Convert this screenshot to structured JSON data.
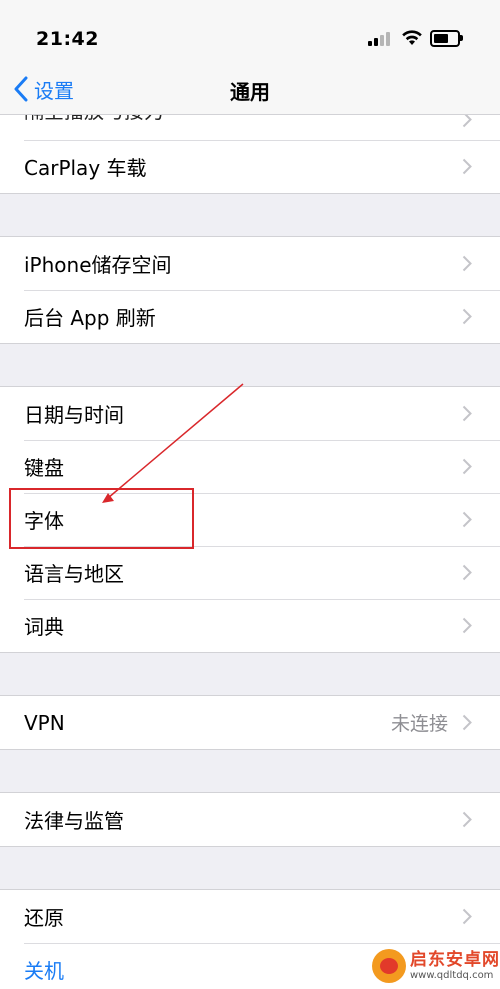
{
  "status_bar": {
    "time": "21:42",
    "icons": [
      "signal-icon",
      "wifi-icon",
      "battery-icon"
    ]
  },
  "nav": {
    "back_label": "设置",
    "title": "通用"
  },
  "groups": [
    {
      "rows": [
        {
          "label": "隔空播放与接力",
          "partial": true
        },
        {
          "label": "CarPlay 车载"
        }
      ]
    },
    {
      "rows": [
        {
          "label": "iPhone储存空间"
        },
        {
          "label": "后台 App 刷新"
        }
      ]
    },
    {
      "rows": [
        {
          "label": "日期与时间"
        },
        {
          "label": "键盘"
        },
        {
          "label": "字体"
        },
        {
          "label": "语言与地区"
        },
        {
          "label": "词典"
        }
      ]
    },
    {
      "rows": [
        {
          "label": "VPN",
          "value": "未连接"
        }
      ]
    },
    {
      "rows": [
        {
          "label": "法律与监管"
        }
      ]
    },
    {
      "rows": [
        {
          "label": "还原"
        },
        {
          "label": "关机",
          "action": true
        }
      ]
    }
  ],
  "annotation": {
    "highlight_color": "#d9272b"
  },
  "watermark": {
    "name": "启东安卓网",
    "url": "www.qdltdq.com"
  },
  "colors": {
    "accent": "#1a7cf5",
    "background": "#efeff4",
    "secondary_text": "#8e8e93"
  }
}
